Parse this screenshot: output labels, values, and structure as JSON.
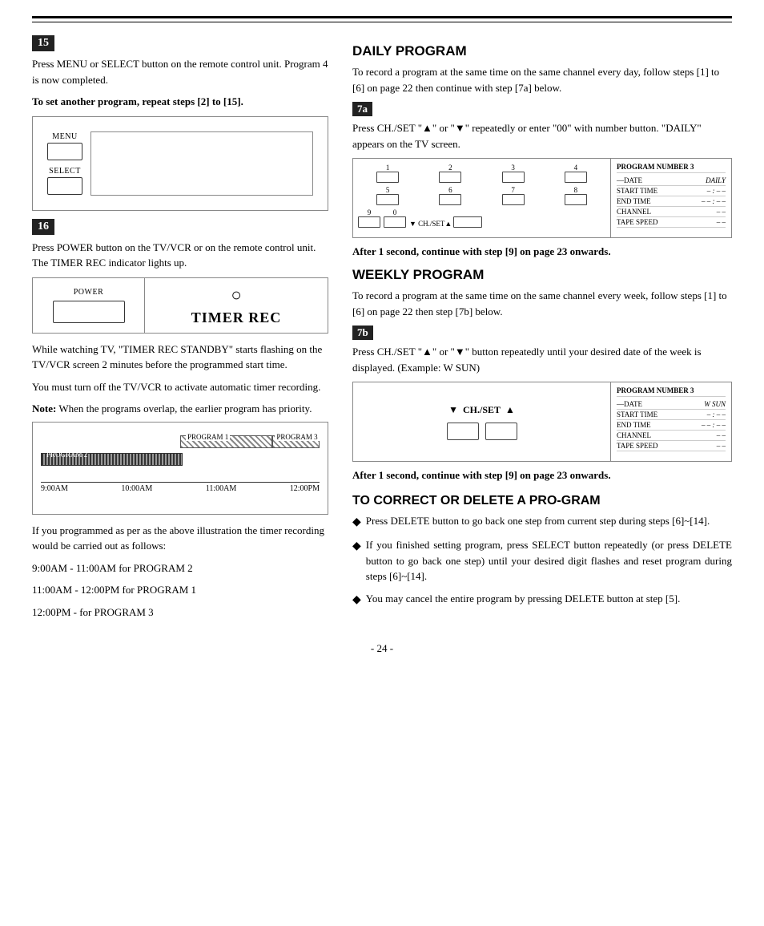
{
  "page": {
    "number": "- 24 -"
  },
  "step15": {
    "badge": "15",
    "text1": "Press MENU or SELECT button on the remote control unit. Program 4 is now completed.",
    "text_bold": "To set another program, repeat steps [2] to [15].",
    "buttons": [
      {
        "label": "MENU"
      },
      {
        "label": "SELECT"
      }
    ]
  },
  "step16": {
    "badge": "16",
    "text1": "Press POWER button on the TV/VCR or on the remote control unit. The TIMER REC indicator lights up.",
    "power_label": "POWER",
    "timer_rec": "TIMER REC",
    "circle": "○",
    "text2": "While watching TV, \"TIMER REC STANDBY\" starts flashing on the TV/VCR screen 2 minutes before the programmed start time.",
    "text3": "You must turn off the TV/VCR to activate automatic timer recording.",
    "note_label": "Note:",
    "note_text": "When the programs overlap, the earlier program has priority.",
    "timeline": {
      "programs": [
        "PROGRAM 1",
        "PROGRAM 3"
      ],
      "times": [
        "9:00AM",
        "10:00AM",
        "11:00AM",
        "12:00PM"
      ]
    },
    "below_text1": "If you programmed as per as the above illustration the timer recording would be carried out as follows:",
    "below_items": [
      "9:00AM - 11:00AM for PROGRAM 2",
      "11:00AM - 12:00PM for PROGRAM 1",
      "12:00PM - for PROGRAM 3"
    ]
  },
  "daily": {
    "title": "DAILY PROGRAM",
    "intro": "To record a program at the same time on the same channel every day, follow steps [1] to [6] on page 22 then continue with step [7a] below.",
    "step_badge": "7a",
    "step_text": "Press CH./SET \"▲\" or \"▼\" repeatedly or enter \"00\" with number button. \"DAILY\" appears on the TV screen.",
    "display": {
      "btn_nums": [
        "1",
        "2",
        "3",
        "4",
        "5",
        "6",
        "7",
        "8",
        "9",
        "0"
      ],
      "ch_set": "▼ CH./SET ▲",
      "program_number": "PROGRAM NUMBER 3",
      "date_label": "—DATE",
      "date_val": "DAILY",
      "start_label": "START TIME",
      "start_val": "–  :  –  –",
      "end_label": "END TIME",
      "end_val": "–  –  :  –  –",
      "channel_label": "CHANNEL",
      "channel_val": "–  –",
      "tape_label": "TAPE SPEED",
      "tape_val": "–  –"
    },
    "after_text": "After 1 second, continue with step [9] on page 23 onwards."
  },
  "weekly": {
    "title": "WEEKLY PROGRAM",
    "intro": "To record a program at the same time on the same channel every week, follow steps [1] to [6] on page 22 then step [7b] below.",
    "step_badge": "7b",
    "step_text": "Press CH./SET \"▲\" or \"▼\" button repeatedly until your desired date of the week is displayed. (Example: W SUN)",
    "display": {
      "ch_set_left": "▼",
      "ch_set_right": "▲",
      "ch_set_mid": "CH./SET",
      "program_number": "PROGRAM NUMBER 3",
      "date_label": "—DATE",
      "date_val": "W SUN",
      "start_label": "START TIME",
      "start_val": "–  :  –  –",
      "end_label": "END TIME",
      "end_val": "–  –  :  –  –",
      "channel_label": "CHANNEL",
      "channel_val": "–  –",
      "tape_label": "TAPE SPEED",
      "tape_val": "–  –"
    },
    "after_text": "After 1 second, continue with step [9] on page 23 onwards."
  },
  "correct": {
    "title": "TO CORRECT OR DELETE A PRO-GRAM",
    "bullets": [
      "Press DELETE button to go back one step from current step during steps [6]~[14].",
      "If you finished setting program, press SELECT button repeatedly (or press DELETE button to go back one step) until your desired digit flashes and reset program during steps [6]~[14].",
      "You may cancel the entire program by pressing DELETE button at step [5]."
    ]
  }
}
